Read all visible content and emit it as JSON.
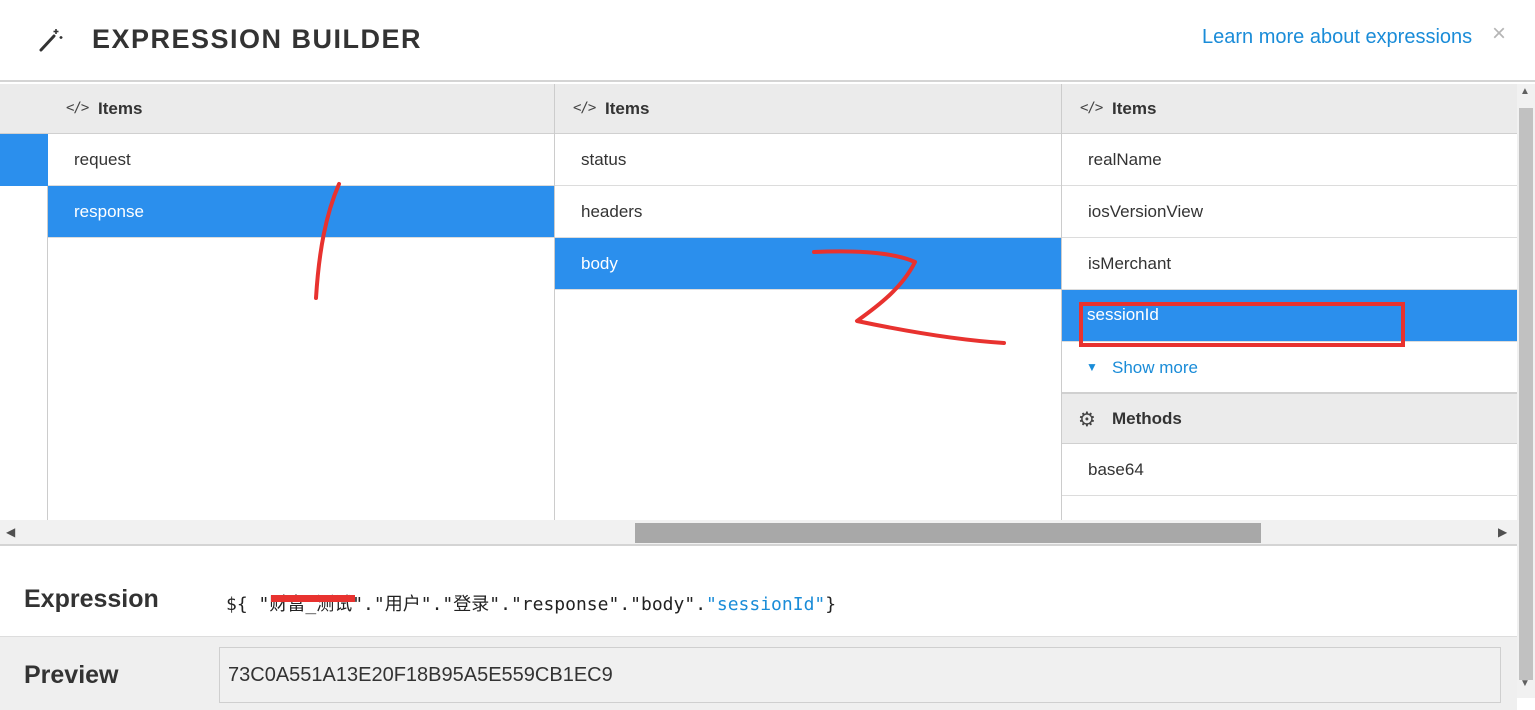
{
  "header": {
    "title": "EXPRESSION BUILDER",
    "learn_more": "Learn more about expressions",
    "close_glyph": "×",
    "wand_icon": "magic-wand-icon"
  },
  "columns": [
    {
      "header": "Items",
      "rows": [
        {
          "label": "request",
          "selected": false
        },
        {
          "label": "response",
          "selected": true
        }
      ]
    },
    {
      "header": "Items",
      "rows": [
        {
          "label": "status",
          "selected": false
        },
        {
          "label": "headers",
          "selected": false
        },
        {
          "label": "body",
          "selected": true
        }
      ]
    },
    {
      "header": "Items",
      "rows": [
        {
          "label": "realName",
          "selected": false
        },
        {
          "label": "iosVersionView",
          "selected": false
        },
        {
          "label": "isMerchant",
          "selected": false
        },
        {
          "label": "sessionId",
          "selected": true
        }
      ],
      "show_more": "Show more",
      "methods_header": "Methods",
      "methods": [
        {
          "label": "base64"
        }
      ]
    }
  ],
  "expression": {
    "label": "Expression",
    "prefix": "${ ",
    "segments": [
      "\"财富_测试\"",
      ".",
      "\"用户\"",
      ".",
      "\"登录\"",
      ".",
      "\"response\"",
      ".",
      "\"body\"",
      "."
    ],
    "highlight": "\"sessionId\"",
    "suffix": "}"
  },
  "preview": {
    "label": "Preview",
    "value": "73C0A551A13E20F18B95A5E559CB1EC9"
  },
  "colors": {
    "selection": "#2b8fed",
    "link": "#1a8cd8",
    "annotation": "#e8322f"
  }
}
